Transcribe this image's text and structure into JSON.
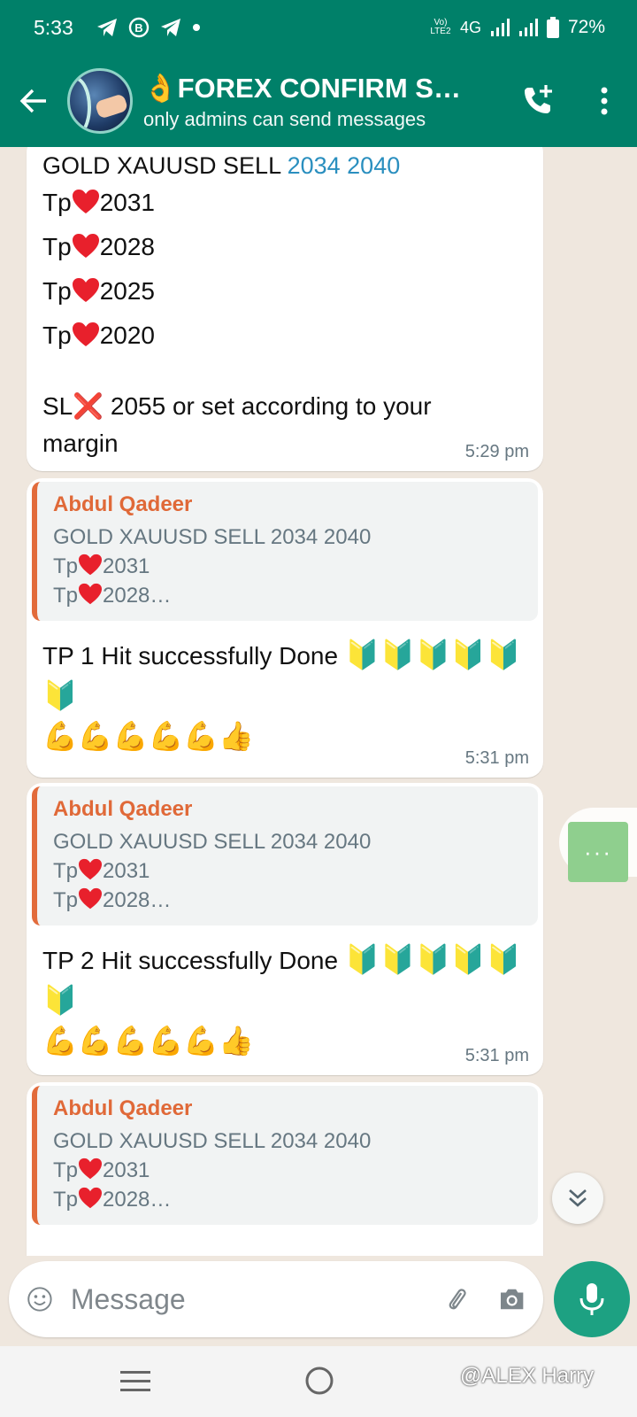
{
  "status_bar": {
    "time": "5:33",
    "network": "4G",
    "battery": "72%",
    "volte": "Vo) LTE2"
  },
  "header": {
    "title": "👌FOREX CONFIRM SI...",
    "subtitle": "only admins can send messages"
  },
  "messages": [
    {
      "text_prefix": "GOLD XAUUSD SELL ",
      "text_link": "2034 2040",
      "tp_lines": [
        "Tp",
        "Tp",
        "Tp",
        "Tp"
      ],
      "tp_values": [
        "2031",
        "2028",
        "2025",
        "2020"
      ],
      "sl_text": "SL❌ 2055 or set according to your margin",
      "time": "5:29 pm"
    },
    {
      "quote_author": "Abdul Qadeer",
      "quote_line1": "GOLD XAUUSD SELL 2034 2040",
      "quote_tp1": "2031",
      "quote_tp2": "2028…",
      "text": "TP 1 Hit successfully Done",
      "shields": "🔰🔰🔰🔰🔰🔰",
      "emojis": "💪💪💪💪💪👍",
      "time": "5:31 pm"
    },
    {
      "quote_author": "Abdul Qadeer",
      "quote_line1": "GOLD XAUUSD SELL 2034 2040",
      "quote_tp1": "2031",
      "quote_tp2": "2028…",
      "text": "TP 2 Hit successfully Done",
      "shields": "🔰🔰🔰🔰🔰🔰",
      "emojis": "💪💪💪💪💪👍",
      "time": "5:31 pm"
    },
    {
      "quote_author": "Abdul Qadeer",
      "quote_line1": "GOLD XAUUSD SELL 2034 2040",
      "quote_tp1": "2031",
      "quote_tp2": "2028…"
    }
  ],
  "tp_label": "Tp",
  "more_button_label": "···",
  "input": {
    "placeholder": "Message"
  },
  "watermark": "@ALEX Harry",
  "colors": {
    "header": "#008069",
    "quote_accent": "#e26b3b",
    "link": "#2a8fbf",
    "fab": "#1da182"
  }
}
